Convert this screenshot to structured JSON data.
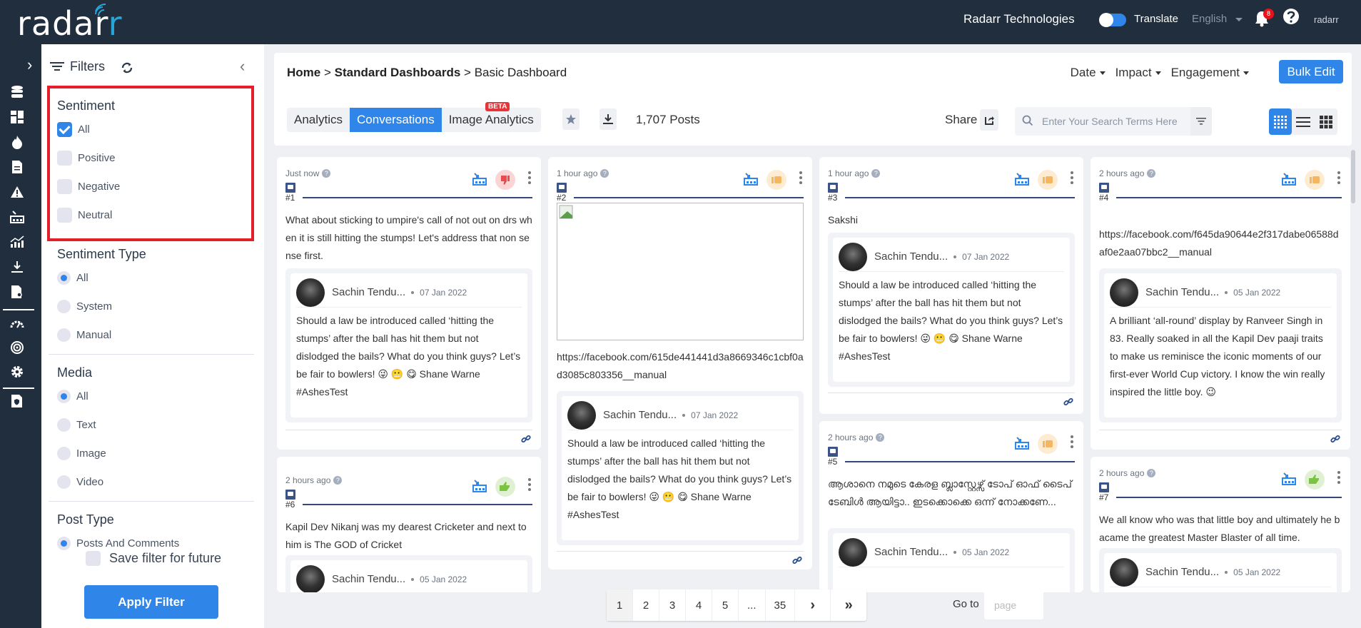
{
  "app": {
    "logo_text_main": "radar",
    "logo_text_accent": "r",
    "company": "Radarr Technologies",
    "translate_label": "Translate",
    "language": "English",
    "notification_count": "8",
    "small_logo": "radarr",
    "colors": {
      "primary": "#2f86e8",
      "topbar": "#202e3e",
      "negative": "#e84c4c",
      "neutral": "#f5b661",
      "positive": "#7cc243"
    }
  },
  "rail": {
    "items": [
      "database-icon",
      "dashboard-icon",
      "fire-icon",
      "document-icon",
      "alert-icon",
      "factory-icon",
      "analytics-icon",
      "download-icon",
      "report-search-icon",
      "speedometer-icon",
      "target-icon",
      "settings-icon",
      "shield-document-icon"
    ]
  },
  "filters": {
    "title": "Filters",
    "sentiment": {
      "title": "Sentiment",
      "options": [
        {
          "label": "All",
          "checked": true
        },
        {
          "label": "Positive",
          "checked": false
        },
        {
          "label": "Negative",
          "checked": false
        },
        {
          "label": "Neutral",
          "checked": false
        }
      ]
    },
    "sentiment_type": {
      "title": "Sentiment Type",
      "options": [
        {
          "label": "All",
          "selected": true
        },
        {
          "label": "System",
          "selected": false
        },
        {
          "label": "Manual",
          "selected": false
        }
      ]
    },
    "media": {
      "title": "Media",
      "options": [
        {
          "label": "All",
          "selected": true
        },
        {
          "label": "Text",
          "selected": false
        },
        {
          "label": "Image",
          "selected": false
        },
        {
          "label": "Video",
          "selected": false
        }
      ]
    },
    "post_type": {
      "title": "Post Type",
      "options": [
        {
          "label": "Posts And Comments",
          "selected": true
        }
      ]
    },
    "save_label": "Save filter for future",
    "apply_label": "Apply Filter"
  },
  "header": {
    "breadcrumb": {
      "home": "Home",
      "sep": ">",
      "section": "Standard Dashboards",
      "page": "Basic Dashboard"
    },
    "sort": [
      "Date",
      "Impact",
      "Engagement"
    ],
    "bulk_edit": "Bulk Edit",
    "tabs": [
      {
        "label": "Analytics",
        "active": false
      },
      {
        "label": "Conversations",
        "active": true
      },
      {
        "label": "Image Analytics",
        "active": false
      }
    ],
    "beta_badge": "BETA",
    "posts_count": "1,707 Posts",
    "share_label": "Share",
    "search_placeholder": "Enter Your Search Terms Here",
    "search_value": ""
  },
  "cards": [
    {
      "time": "Just now",
      "num": "#1",
      "sentiment": "negative",
      "text": "What about sticking to umpire's call of not out on drs when it is still hitting the stumps! Let's address that non sense first.",
      "author": "Sachin Tendu...",
      "date": "07 Jan 2022",
      "comment": "Should a law be introduced called ‘hitting the stumps’ after the ball has hit them but not dislodged the bails? What do you think guys? Let’s be fair to bowlers! 😜 😬 😋  Shane Warne #AshesTest"
    },
    {
      "time": "1 hour ago",
      "num": "#2",
      "sentiment": "neutral",
      "text": "https://facebook.com/615de441441d3a8669346c1cbf0ad3085c803356__manual",
      "author": "Sachin Tendu...",
      "date": "07 Jan 2022",
      "comment": "Should a law be introduced called ‘hitting the stumps’ after the ball has hit them but not dislodged the bails? What do you think guys? Let’s be fair to bowlers! 😜 😬 😋  Shane Warne #AshesTest"
    },
    {
      "time": "1 hour ago",
      "num": "#3",
      "sentiment": "neutral",
      "text": "Sakshi",
      "author": "Sachin Tendu...",
      "date": "07 Jan 2022",
      "comment": "Should a law be introduced called ‘hitting the stumps’ after the ball has hit them but not dislodged the bails? What do you think guys? Let’s be fair to bowlers! 😜 😬 😋  Shane Warne #AshesTest"
    },
    {
      "time": "2 hours ago",
      "num": "#4",
      "sentiment": "neutral",
      "text": "https://facebook.com/f645da90644e2f317dabe06588daf0e2aa07bbc2__manual",
      "author": "Sachin Tendu...",
      "date": "05 Jan 2022",
      "comment": "A brilliant ‘all-round’ display by Ranveer Singh in 83. Really soaked in all the Kapil Dev paaji traits to make us reminisce the iconic moments of our first-ever World Cup victory. I know the win really inspired the little boy. 😉"
    },
    {
      "time": "2 hours ago",
      "num": "#5",
      "sentiment": "neutral",
      "text": "ആശാനെ നമുടെ കേരള ബ്ലാസ്റ്റേഴ്സ് ടോപ് ഓഫ് ടൈപ് ടേബിൾ ആയിട്ടാ.. ഇടക്കൊക്കെ ഒന്ന് നോക്കണേ...",
      "author": "Sachin Tendu...",
      "date": "05 Jan 2022",
      "comment": ""
    },
    {
      "time": "2 hours ago",
      "num": "#6",
      "sentiment": "positive",
      "text": "Kapil Dev Nikanj was my dearest Cricketer and next to him is The GOD of Cricket",
      "author": "Sachin Tendu...",
      "date": "05 Jan 2022",
      "comment": ""
    },
    {
      "time": "2 hours ago",
      "num": "#7",
      "sentiment": "positive",
      "text": "We all know who was that little boy and ultimately he bacame the greatest Master Blaster of all time.",
      "author": "Sachin Tendu...",
      "date": "05 Jan 2022",
      "comment": ""
    }
  ],
  "pagination": {
    "pages": [
      "1",
      "2",
      "3",
      "4",
      "5",
      "...",
      "35"
    ],
    "current": "1",
    "next": "›",
    "last": "»",
    "goto_label": "Go to",
    "goto_placeholder": "page"
  }
}
